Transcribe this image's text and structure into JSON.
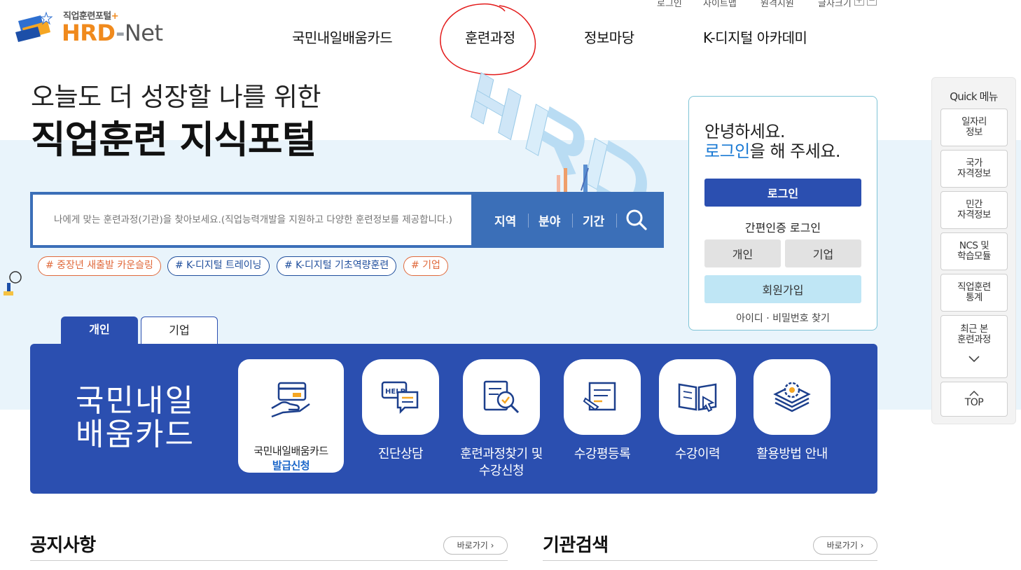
{
  "utility": {
    "login": "로그인",
    "sitemap": "사이트맵",
    "remote": "원격지원",
    "font_size": "글자크기",
    "plus": "+",
    "minus": "−"
  },
  "logo": {
    "sub": "직업훈련포털",
    "plus": "+",
    "hrd": "HRD",
    "dash": "-",
    "net": "Net"
  },
  "gnb": {
    "items": [
      "국민내일배움카드",
      "훈련과정",
      "정보마당",
      "K-디지털 아카데미"
    ]
  },
  "hero": {
    "line1": "오늘도 더 성장할 나를 위한",
    "line2": "직업훈련 지식포털"
  },
  "search": {
    "placeholder": "나에게 맞는 훈련과정(기관)을 찾아보세요.(직업능력개발을 지원하고 다양한 훈련정보를 제공합니다.)",
    "filters": [
      "지역",
      "분야",
      "기간"
    ]
  },
  "hashtags": [
    "# 중장년 새출발 카운슬링",
    "# K-디지털 트레이닝",
    "# K-디지털 기초역량훈련",
    "# 기업"
  ],
  "login_panel": {
    "greeting": "안녕하세요.",
    "login_link": "로그인",
    "greeting_rest": "을 해 주세요.",
    "login_button": "로그인",
    "easy_login": "간편인증 로그인",
    "personal": "개인",
    "company": "기업",
    "join": "회원가입",
    "find": "아이디 · 비밀번호 찾기"
  },
  "quick_menu": {
    "title": "Quick 메뉴",
    "items": [
      {
        "l1": "일자리",
        "l2": "정보"
      },
      {
        "l1": "국가",
        "l2": "자격정보"
      },
      {
        "l1": "민간",
        "l2": "자격정보"
      },
      {
        "l1": "NCS 및",
        "l2": "학습모듈"
      },
      {
        "l1": "직업훈련",
        "l2": "통계"
      },
      {
        "l1": "최근 본",
        "l2": "훈련과정"
      }
    ],
    "top": "TOP"
  },
  "tabs": {
    "personal": "개인",
    "company": "기업"
  },
  "card_section": {
    "title_line1": "국민내일",
    "title_line2": "배움카드",
    "big_card_line1": "국민내일배움카드",
    "big_card_line2": "발급신청",
    "items": [
      {
        "label": "진단상담",
        "icon": "help-chat-icon"
      },
      {
        "label": "훈련과정찾기 및 수강신청",
        "icon": "document-search-icon"
      },
      {
        "label": "수강평등록",
        "icon": "scroll-write-icon"
      },
      {
        "label": "수강이력",
        "icon": "open-book-icon"
      },
      {
        "label": "활용방법 안내",
        "icon": "gear-layers-icon"
      }
    ],
    "item2_line1": "훈련과정찾기 및",
    "item2_line2": "수강신청"
  },
  "bottom": {
    "notice_title": "공지사항",
    "institution_title": "기관검색",
    "goto": "바로가기 ›"
  },
  "colors": {
    "primary": "#2b4fb0",
    "accent_orange": "#f08a1d",
    "band": "#e9f4fb",
    "link": "#1a7ad4",
    "annotation_red": "#e31b1b"
  }
}
